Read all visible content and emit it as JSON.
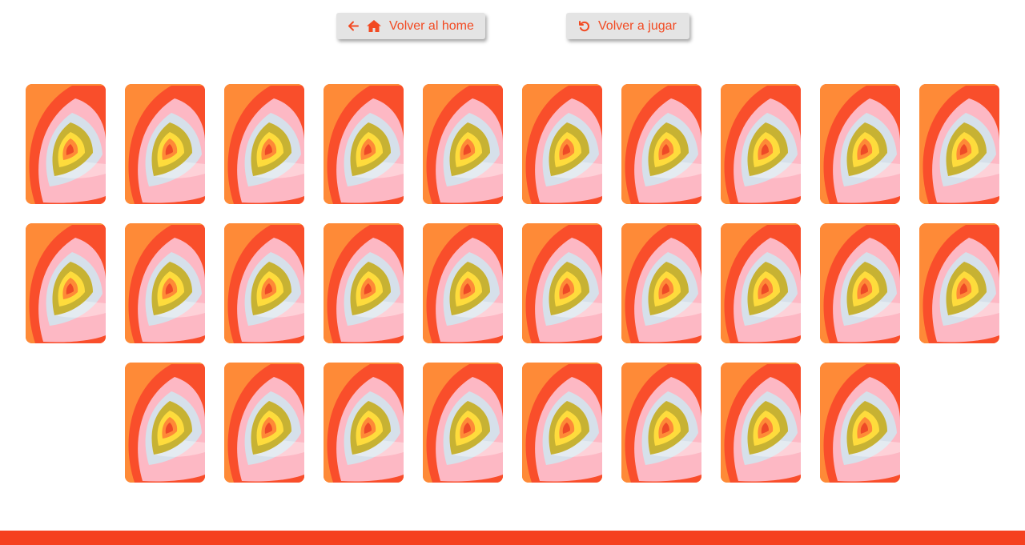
{
  "toolbar": {
    "home_label": "Volver al home",
    "replay_label": "Volver a jugar",
    "icons": {
      "back": "arrow-left-icon",
      "home": "house-icon",
      "replay": "rotate-left-icon"
    }
  },
  "board": {
    "rows": [
      {
        "card_count": 10
      },
      {
        "card_count": 10
      },
      {
        "card_count": 8
      }
    ],
    "card_state": "face-down"
  },
  "colors": {
    "accent": "#f24a22",
    "button_bg": "#e4e4e4",
    "card_outer": "#fe8a37",
    "card_red": "#f94e2b",
    "card_pink": "#fdb8c4",
    "card_grey": "#d6e0ea",
    "card_olive": "#c7b233",
    "card_yellow": "#fedc3c",
    "card_orange": "#fe8a37",
    "card_center": "#ee4a27",
    "footer": "#f5401f"
  }
}
